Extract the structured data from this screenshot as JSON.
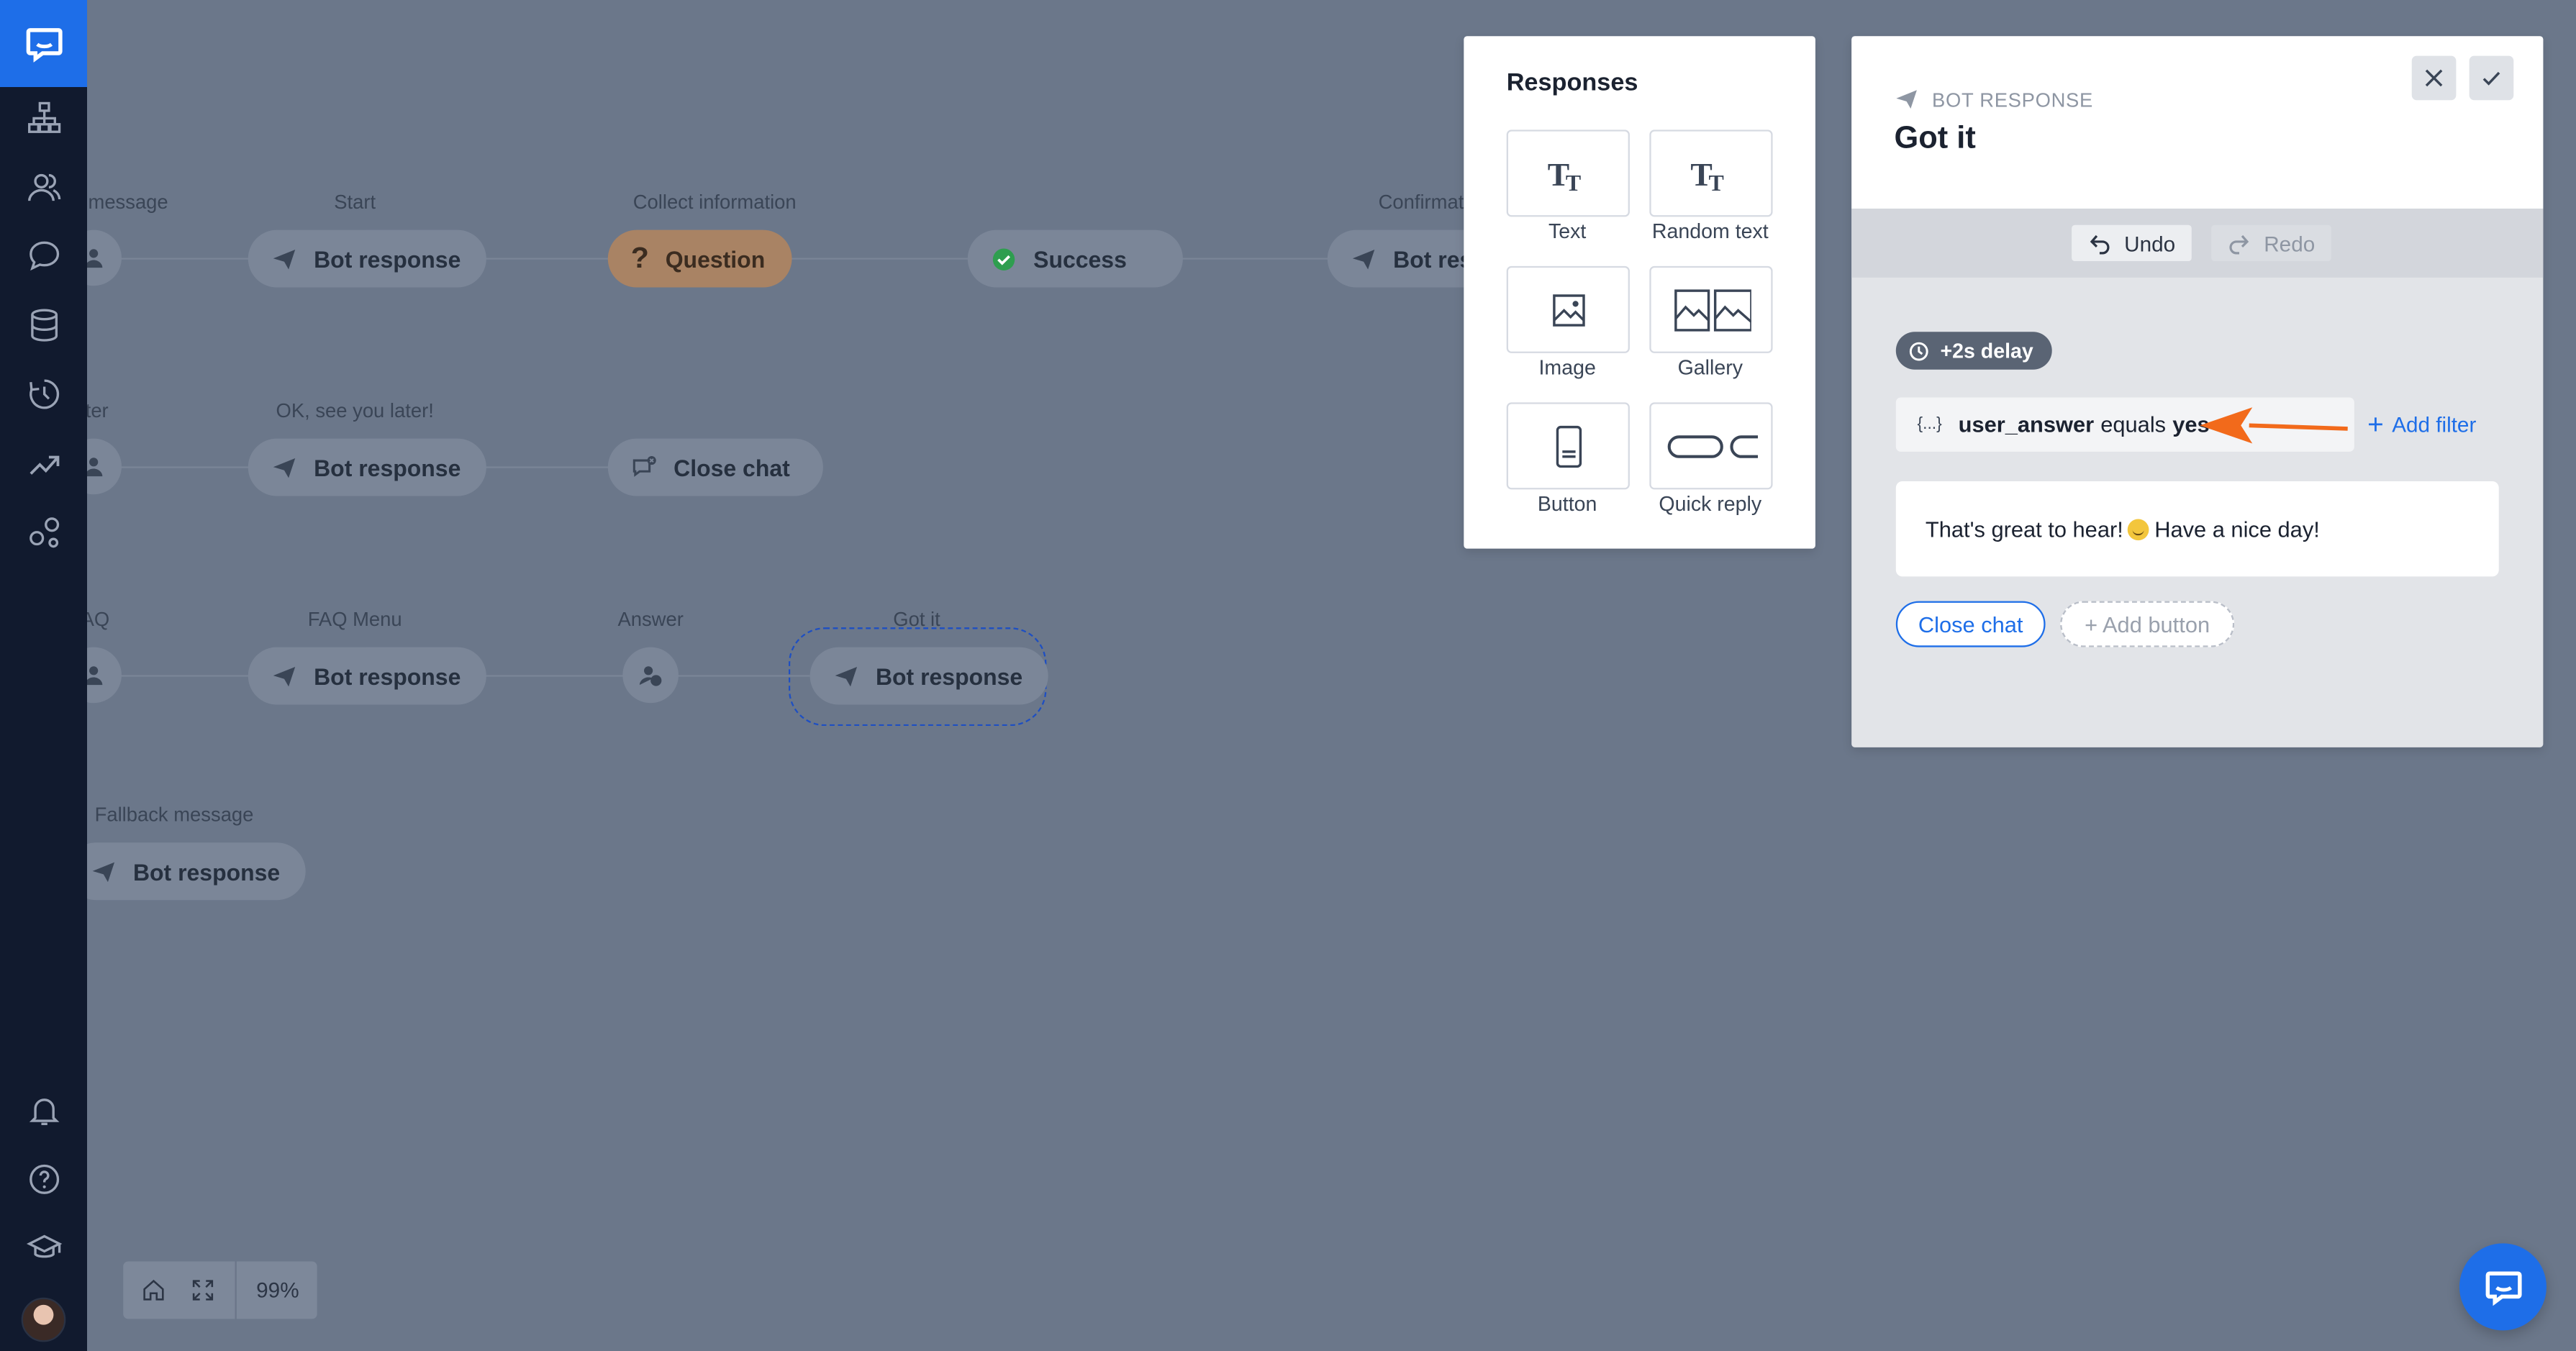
{
  "canvas": {
    "nodes": [
      {
        "label": "message",
        "type": "Bot response"
      },
      {
        "label": "Start",
        "text": "Bot response"
      },
      {
        "label": "Collect information",
        "text": "Question"
      },
      {
        "text": "Success"
      },
      {
        "label": "Confirmat",
        "text": "Bot resp"
      },
      {
        "label": "ter"
      },
      {
        "label": "OK, see you later!",
        "text": "Bot response"
      },
      {
        "text": "Close chat"
      },
      {
        "label": "AQ"
      },
      {
        "label": "FAQ Menu",
        "text": "Bot response"
      },
      {
        "label": "Answer"
      },
      {
        "label": "Got it",
        "text": "Bot response"
      },
      {
        "label": "Fallback message",
        "text": "Bot response"
      }
    ],
    "zoom": "99%"
  },
  "responses": {
    "title": "Responses",
    "items": [
      {
        "label": "Text",
        "icon": "text-icon"
      },
      {
        "label": "Random text",
        "icon": "random-text-icon"
      },
      {
        "label": "Image",
        "icon": "image-icon"
      },
      {
        "label": "Gallery",
        "icon": "gallery-icon"
      },
      {
        "label": "Button",
        "icon": "button-icon"
      },
      {
        "label": "Quick reply",
        "icon": "quick-reply-icon"
      }
    ]
  },
  "panel": {
    "kicker": "BOT RESPONSE",
    "title": "Got it",
    "undo": "Undo",
    "redo": "Redo",
    "delay": "+2s delay",
    "filter": {
      "brace": "{...}",
      "variable": "user_answer",
      "operator": "equals",
      "value": "yes"
    },
    "add_filter": "Add filter",
    "message_before": "That's great to hear!",
    "message_after": "Have a nice day!",
    "button_label": "Close chat",
    "add_button": "+ Add button"
  },
  "colors": {
    "accent": "#1e6ee8",
    "sidebar": "#111a2e",
    "canvas_overlay": "#6b778a",
    "arrow": "#f26a1b",
    "success": "#2e9e4f"
  }
}
